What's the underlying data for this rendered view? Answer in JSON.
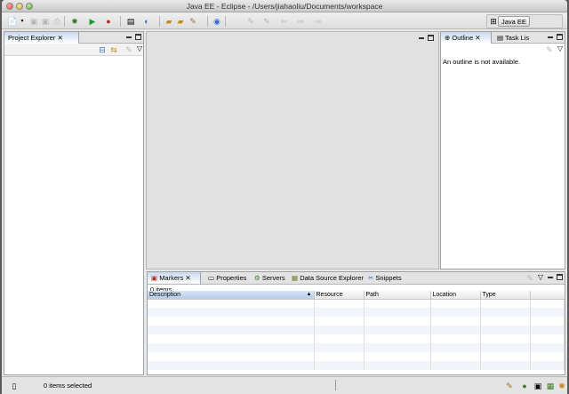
{
  "window": {
    "title": "Java EE - Eclipse - /Users/jiahaoliu/Documents/workspace"
  },
  "toolbar": {
    "icons": [
      "new-icon",
      "save-icon",
      "save-all-icon",
      "print-icon",
      "debug-icon",
      "run-icon",
      "external-tools-icon",
      "new-server-icon",
      "open-type-icon",
      "open-task-icon",
      "search-icon",
      "globe-icon",
      "nav-back-icon",
      "nav-forward-icon"
    ],
    "perspective_label": "Java EE"
  },
  "project_explorer": {
    "tab_label": "Project Explorer"
  },
  "outline": {
    "tab_label": "Outline",
    "second_tab_label": "Task Lis",
    "message": "An outline is not available."
  },
  "bottom": {
    "tabs": [
      {
        "label": "Markers"
      },
      {
        "label": "Properties"
      },
      {
        "label": "Servers"
      },
      {
        "label": "Data Source Explorer"
      },
      {
        "label": "Snippets"
      }
    ],
    "count": "0 items",
    "columns": [
      "Description",
      "Resource",
      "Path",
      "Location",
      "Type"
    ]
  },
  "status": {
    "text": "0 items selected"
  },
  "colors": {
    "active_tab": "#c9d9ef",
    "panel_border": "#9ea3aa",
    "window_bg": "#e8e8e8"
  }
}
